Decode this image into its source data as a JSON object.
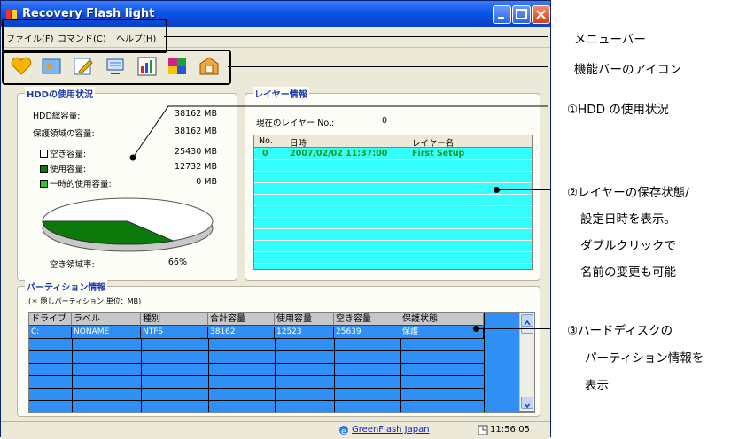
{
  "window": {
    "title": "Recovery Flash light"
  },
  "menu": [
    "ファイル(F)",
    "コマンド(C)",
    "ヘルプ(H)"
  ],
  "toolbar_icons": [
    "heart-icon",
    "back-icon",
    "edit-icon",
    "display-icon",
    "chart-icon",
    "palette-icon",
    "tools-icon"
  ],
  "hdd": {
    "title": "HDDの使用状況",
    "total_label": "HDD総容量:",
    "total_value": "38162 MB",
    "protected_label": "保護領域の容量:",
    "protected_value": "38162 MB",
    "free_label": "空き容量:",
    "free_value": "25430 MB",
    "used_label": "使用容量:",
    "used_value": "12732 MB",
    "temp_label": "一時的使用容量:",
    "temp_value": "0 MB",
    "rate_label": "空き領域率:",
    "rate_value": "66%",
    "free_percent": 66,
    "colors": {
      "free": "#ffffff",
      "used": "#0b7a0b",
      "temp": "#22cc22"
    }
  },
  "layer": {
    "title": "レイヤー情報",
    "current_label": "現在のレイヤー  No.:",
    "current_value": "0",
    "headers": [
      "No.",
      "日時",
      "レイヤー名"
    ],
    "rows": [
      {
        "no": "0",
        "date": "2007/02/02 11:37:00",
        "name": "First Setup"
      }
    ]
  },
  "partition": {
    "title": "パーティション情報",
    "note": "(＊ 隠しパーティション  単位：MB)",
    "headers": [
      "ドライブ",
      "ラベル",
      "種別",
      "合計容量",
      "使用容量",
      "空き容量",
      "保護状態"
    ],
    "rows": [
      [
        "C:",
        "NONAME",
        "NTFS",
        "38162",
        "12523",
        "25639",
        "保護"
      ]
    ]
  },
  "status": {
    "link": "GreenFlash Japan",
    "time": "11:56:05"
  },
  "annotations": {
    "menubar": "メニューバー",
    "toolbar": "機能バーのアイコン",
    "hdd": "①HDD の使用状況",
    "layer1": "②レイヤーの保存状態/",
    "layer2": "設定日時を表示。",
    "layer3": "ダブルクリックで",
    "layer4": "名前の変更も可能",
    "part1": "③ハードディスクの",
    "part2": "パーティション情報を",
    "part3": "表示"
  }
}
